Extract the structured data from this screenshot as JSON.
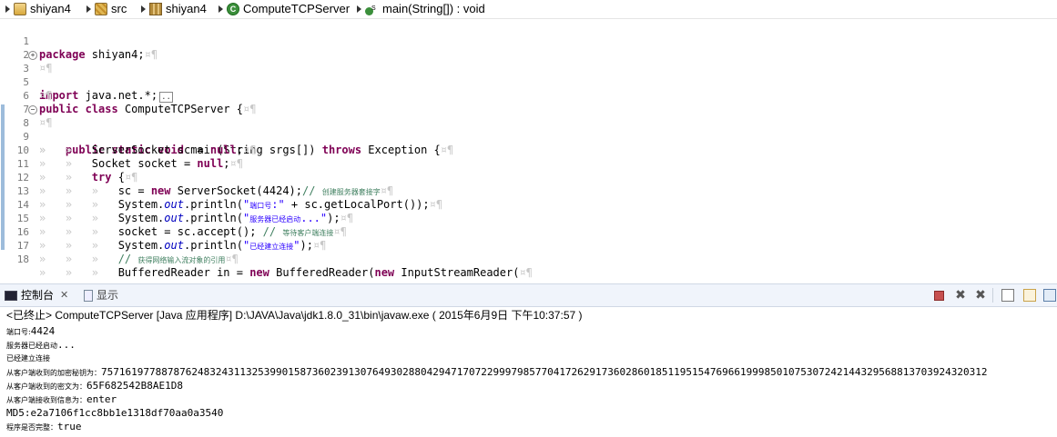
{
  "breadcrumb": {
    "project": "shiyan4",
    "src": "src",
    "package": "shiyan4",
    "class": "ComputeTCPServer",
    "method": "main(String[]) : void"
  },
  "editor": {
    "lines": [
      {
        "n": "1",
        "code": "package shiyan4;"
      },
      {
        "n": "2",
        "code": ""
      },
      {
        "n": "3",
        "code": "import java.net.*;"
      },
      {
        "n": "5",
        "code": ""
      },
      {
        "n": "6",
        "code": "public class ComputeTCPServer {"
      },
      {
        "n": "7",
        "code": ""
      },
      {
        "n": "8",
        "code": "public static void main(String srgs[]) throws Exception {"
      },
      {
        "n": "9",
        "code": "ServerSocket sc = null;"
      },
      {
        "n": "10",
        "code": "Socket socket = null;"
      },
      {
        "n": "11",
        "code": "try {"
      },
      {
        "n": "12",
        "code": "sc = new ServerSocket(4424);// 创建服务器套接字"
      },
      {
        "n": "13",
        "code": "System.out.println(\"端口号:\" + sc.getLocalPort());"
      },
      {
        "n": "14",
        "code": "System.out.println(\"服务器已经启动...\");"
      },
      {
        "n": "15",
        "code": "socket = sc.accept(); // 等待客户端连接"
      },
      {
        "n": "16",
        "code": "System.out.println(\"已经建立连接\");"
      },
      {
        "n": "17",
        "code": "// 获得网络输入流对象的引用"
      },
      {
        "n": "18",
        "code": "BufferedReader in = new BufferedReader(new InputStreamReader("
      }
    ]
  },
  "console": {
    "tab_console": "控制台",
    "tab_display": "显示",
    "header": "<已终止> ComputeTCPServer [Java 应用程序] D:\\JAVA\\Java\\jdk1.8.0_31\\bin\\javaw.exe ( 2015年6月9日 下午10:37:57 )",
    "out_port_label": "端口号:",
    "out_port_value": "4424",
    "out_started_label": "服务器已经启动",
    "out_started_suffix": "...",
    "out_connected": "已经建立连接",
    "out_key_label": "从客户端收到的加密秘钥为：",
    "out_key_value": "757161977887876248324311325399015873602391307649302880429471707229997985770417262917360286018511951547696619998501075307242144329568813703924320312",
    "out_cipher_label": "从客户端收到的密文为：",
    "out_cipher_value": "65F682542B8AE1D8",
    "out_info_label": "从客户端接收到信息为：",
    "out_info_value": "enter",
    "out_md5": "MD5:e2a7106f1cc8bb1e1318df70aa0a3540",
    "out_match_label": "程序是否完整：",
    "out_match_value": "true"
  }
}
